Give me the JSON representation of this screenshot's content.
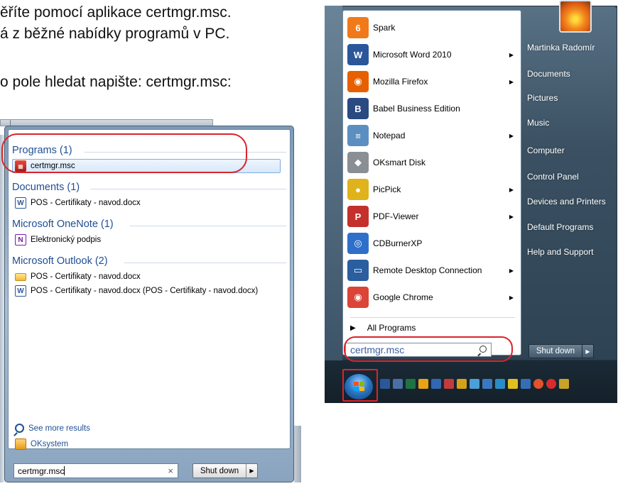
{
  "doc": {
    "line1": "ěříte pomocí aplikace certmgr.msc.",
    "line2": "á z běžné nabídky programů v PC.",
    "line3": "o pole hledat napište: certmgr.msc:"
  },
  "search_menu": {
    "groups": [
      {
        "title": "Programs (1)",
        "items": [
          {
            "label": "certmgr.msc",
            "icon": "certmgr-icon"
          }
        ]
      },
      {
        "title": "Documents (1)",
        "items": [
          {
            "label": "POS - Certifikaty - navod.docx",
            "icon": "word-doc-icon"
          }
        ]
      },
      {
        "title": "Microsoft OneNote (1)",
        "items": [
          {
            "label": "Elektronický podpis",
            "icon": "onenote-icon"
          }
        ]
      },
      {
        "title": "Microsoft Outlook (2)",
        "items": [
          {
            "label": "POS - Certifikaty - navod.docx",
            "icon": "mail-icon"
          },
          {
            "label": "POS - Certifikaty - navod.docx (POS - Certifikaty - navod.docx)",
            "icon": "mail-attachment-icon"
          }
        ]
      }
    ],
    "see_more": "See more results",
    "oksystem": "OKsystem",
    "search_value": "certmgr.msc",
    "clear_glyph": "×",
    "shutdown_label": "Shut down",
    "shutdown_arrow": "▶"
  },
  "start_menu": {
    "programs": [
      {
        "label": "Spark",
        "icon": "spark-icon",
        "arrow": false,
        "color": "#f07a1a",
        "glyph": "6"
      },
      {
        "label": "Microsoft Word 2010",
        "icon": "word-icon",
        "arrow": true,
        "color": "#2b579a",
        "glyph": "W"
      },
      {
        "label": "Mozilla Firefox",
        "icon": "firefox-icon",
        "arrow": true,
        "color": "#e66000",
        "glyph": "◉"
      },
      {
        "label": "Babel Business Edition",
        "icon": "babel-icon",
        "arrow": false,
        "color": "#2a4a82",
        "glyph": "B"
      },
      {
        "label": "Notepad",
        "icon": "notepad-icon",
        "arrow": true,
        "color": "#5b8fc1",
        "glyph": "≡"
      },
      {
        "label": "OKsmart Disk",
        "icon": "oksmart-disk-icon",
        "arrow": false,
        "color": "#8a8f96",
        "glyph": "◆"
      },
      {
        "label": "PicPick",
        "icon": "picpick-icon",
        "arrow": true,
        "color": "#e0b21c",
        "glyph": "●"
      },
      {
        "label": "PDF-Viewer",
        "icon": "pdf-viewer-icon",
        "arrow": true,
        "color": "#c4302b",
        "glyph": "P"
      },
      {
        "label": "CDBurnerXP",
        "icon": "cdburner-icon",
        "arrow": false,
        "color": "#2f6fc9",
        "glyph": "◎"
      },
      {
        "label": "Remote Desktop Connection",
        "icon": "remote-desktop-icon",
        "arrow": true,
        "color": "#2a5e9e",
        "glyph": "▭"
      },
      {
        "label": "Google Chrome",
        "icon": "chrome-icon",
        "arrow": true,
        "color": "#db4437",
        "glyph": "◉"
      }
    ],
    "all_programs": "All Programs",
    "all_programs_glyph": "▶",
    "search_value": "certmgr.msc",
    "right_links": [
      "Martinka Radomír",
      "Documents",
      "Pictures",
      "Music",
      "Computer",
      "Control Panel",
      "Devices and Printers",
      "Default Programs",
      "Help and Support"
    ],
    "shutdown_label": "Shut down",
    "shutdown_arrow": "▶"
  },
  "colors": {
    "annotation_ring": "#d9242b",
    "group_heading": "#1e4f94"
  }
}
